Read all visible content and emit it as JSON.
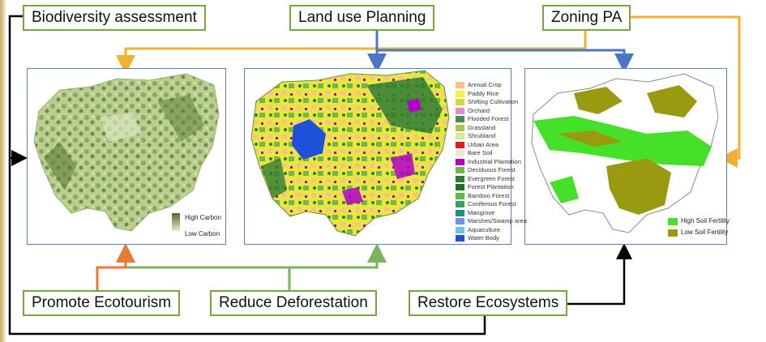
{
  "labels": {
    "biodiversity": "Biodiversity assessment",
    "land_use": "Land use Planning",
    "zoning": "Zoning PA",
    "ecotourism": "Promote Ecotourism",
    "deforestation": "Reduce Deforestation",
    "restore": "Restore Ecosystems"
  },
  "carbon_legend": {
    "high": "High Carbon",
    "low": "Low Carbon"
  },
  "landuse_legend": [
    {
      "label": "Annual Crop",
      "color": "#f5c18c"
    },
    {
      "label": "Paddy Rice",
      "color": "#f7f03a"
    },
    {
      "label": "Shifting Cultivation",
      "color": "#d9d63a"
    },
    {
      "label": "Orchard",
      "color": "#e08ad0"
    },
    {
      "label": "Flooded Forest",
      "color": "#4e8a50"
    },
    {
      "label": "Grassland",
      "color": "#a8c84a"
    },
    {
      "label": "Shrubland",
      "color": "#d6e8a0"
    },
    {
      "label": "Urban Area",
      "color": "#e41a1c"
    },
    {
      "label": "Bare Soil",
      "color": "#f2e6d0"
    },
    {
      "label": "Industrial Plantation",
      "color": "#b000c8"
    },
    {
      "label": "Deciduous Forest",
      "color": "#74b64c"
    },
    {
      "label": "Evergreen Forest",
      "color": "#2e7d32"
    },
    {
      "label": "Forest Plantation",
      "color": "#1f6e24"
    },
    {
      "label": "Bamboo Forest",
      "color": "#58c040"
    },
    {
      "label": "Coniferous Forest",
      "color": "#3aa060"
    },
    {
      "label": "Mangrove",
      "color": "#1a9080"
    },
    {
      "label": "Marshes/Swamp area",
      "color": "#7a8ee6"
    },
    {
      "label": "Aquaculture",
      "color": "#6ec2f2"
    },
    {
      "label": "Water Body",
      "color": "#1e50d8"
    }
  ],
  "soil_legend": [
    {
      "label": "High Soil Fertility",
      "color": "#44e02a"
    },
    {
      "label": "Low Soil Fertility",
      "color": "#9a9a10"
    }
  ],
  "colors": {
    "box_border": "#77a83a",
    "panel_border": "#5b7fc5",
    "arrow_orange": "#f0b030",
    "arrow_blue": "#4a76c8",
    "arrow_green": "#7ab55c",
    "arrow_red_orange": "#e87a35",
    "arrow_black": "#000000"
  }
}
